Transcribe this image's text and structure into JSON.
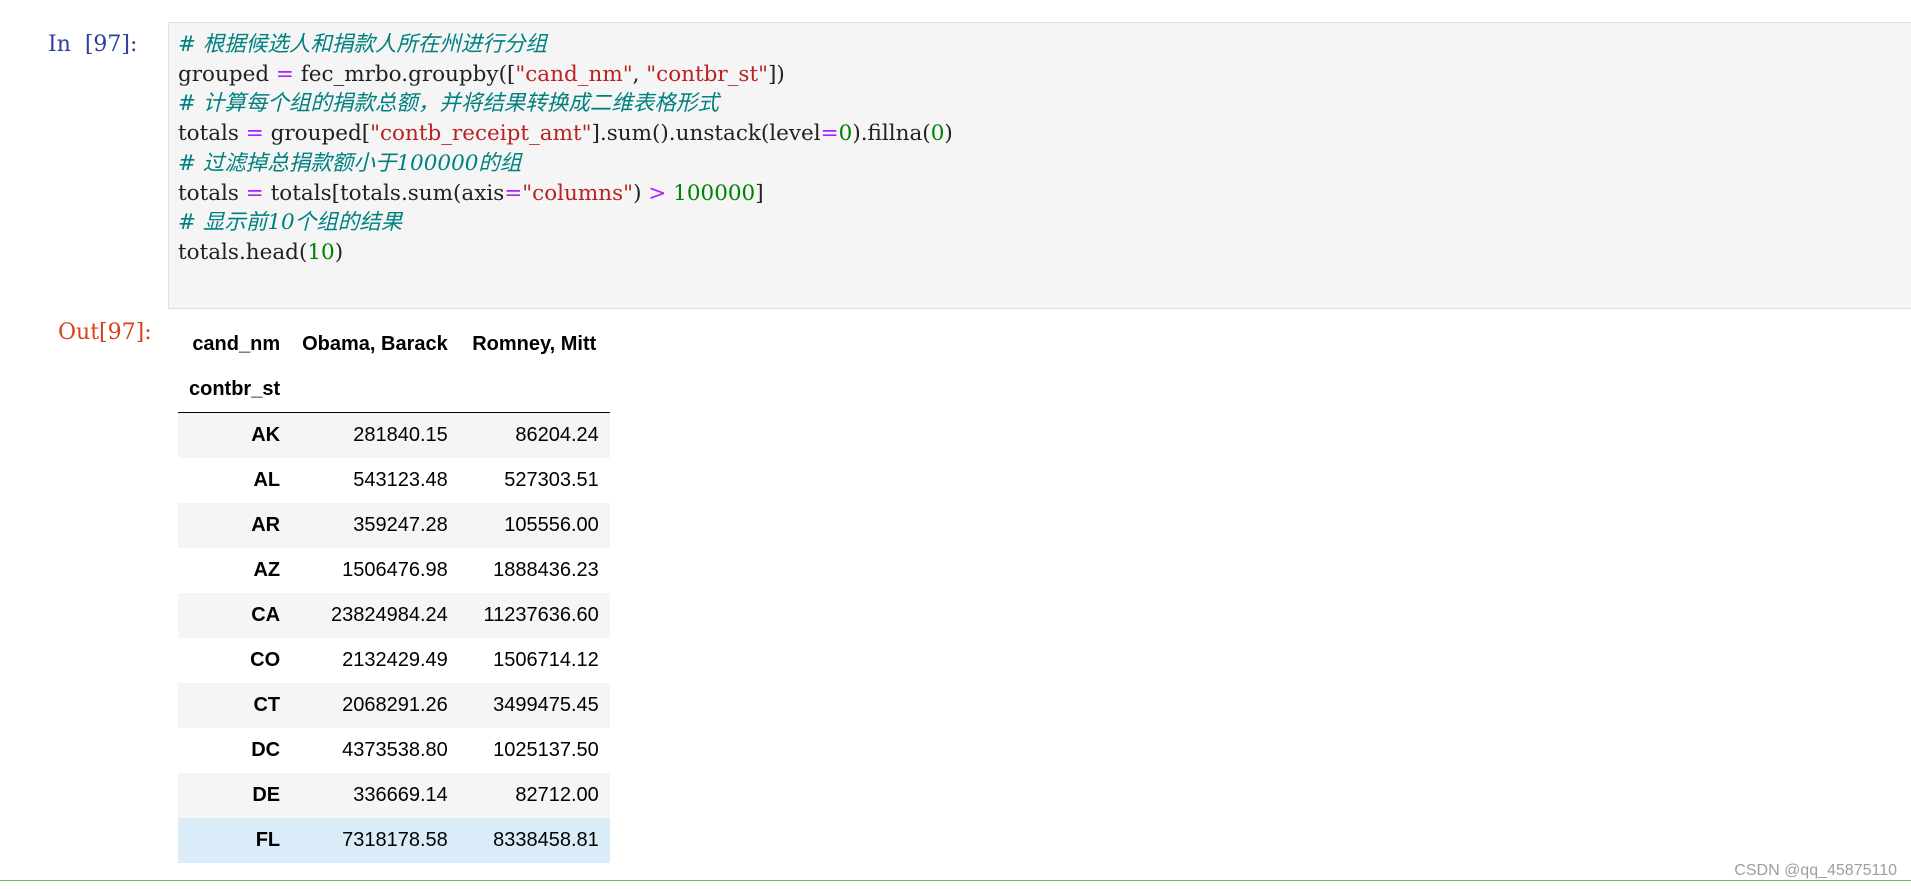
{
  "input_cell": {
    "prompt": "In  [97]:",
    "code_lines": [
      [
        {
          "t": "cm",
          "v": "# 根据候选人和捐款人所在州进行分组"
        }
      ],
      [
        {
          "t": "",
          "v": "grouped "
        },
        {
          "t": "op",
          "v": "="
        },
        {
          "t": "",
          "v": " fec_mrbo.groupby(["
        },
        {
          "t": "str",
          "v": "\"cand_nm\""
        },
        {
          "t": "",
          "v": ", "
        },
        {
          "t": "str",
          "v": "\"contbr_st\""
        },
        {
          "t": "",
          "v": "])"
        }
      ],
      [
        {
          "t": "cm",
          "v": "# 计算每个组的捐款总额，并将结果转换成二维表格形式"
        }
      ],
      [
        {
          "t": "",
          "v": "totals "
        },
        {
          "t": "op",
          "v": "="
        },
        {
          "t": "",
          "v": " grouped["
        },
        {
          "t": "str",
          "v": "\"contb_receipt_amt\""
        },
        {
          "t": "",
          "v": "].sum().unstack(level"
        },
        {
          "t": "op",
          "v": "="
        },
        {
          "t": "num",
          "v": "0"
        },
        {
          "t": "",
          "v": ").fillna("
        },
        {
          "t": "num",
          "v": "0"
        },
        {
          "t": "",
          "v": ")"
        }
      ],
      [
        {
          "t": "cm",
          "v": "# 过滤掉总捐款额小于100000的组"
        }
      ],
      [
        {
          "t": "",
          "v": "totals "
        },
        {
          "t": "op",
          "v": "="
        },
        {
          "t": "",
          "v": " totals[totals.sum(axis"
        },
        {
          "t": "op",
          "v": "="
        },
        {
          "t": "str",
          "v": "\"columns\""
        },
        {
          "t": "",
          "v": ") "
        },
        {
          "t": "op",
          "v": ">"
        },
        {
          "t": "",
          "v": " "
        },
        {
          "t": "num",
          "v": "100000"
        },
        {
          "t": "",
          "v": "]"
        }
      ],
      [
        {
          "t": "cm",
          "v": "# 显示前10个组的结果"
        }
      ],
      [
        {
          "t": "",
          "v": "totals.head("
        },
        {
          "t": "num",
          "v": "10"
        },
        {
          "t": "",
          "v": ")"
        }
      ]
    ]
  },
  "output_cell": {
    "prompt": "Out[97]:",
    "table": {
      "columns_name": "cand_nm",
      "index_name": "contbr_st",
      "columns": [
        "Obama, Barack",
        "Romney, Mitt"
      ],
      "rows": [
        {
          "index": "AK",
          "values": [
            "281840.15",
            "86204.24"
          ]
        },
        {
          "index": "AL",
          "values": [
            "543123.48",
            "527303.51"
          ]
        },
        {
          "index": "AR",
          "values": [
            "359247.28",
            "105556.00"
          ]
        },
        {
          "index": "AZ",
          "values": [
            "1506476.98",
            "1888436.23"
          ]
        },
        {
          "index": "CA",
          "values": [
            "23824984.24",
            "11237636.60"
          ]
        },
        {
          "index": "CO",
          "values": [
            "2132429.49",
            "1506714.12"
          ]
        },
        {
          "index": "CT",
          "values": [
            "2068291.26",
            "3499475.45"
          ]
        },
        {
          "index": "DC",
          "values": [
            "4373538.80",
            "1025137.50"
          ]
        },
        {
          "index": "DE",
          "values": [
            "336669.14",
            "82712.00"
          ]
        },
        {
          "index": "FL",
          "values": [
            "7318178.58",
            "8338458.81"
          ],
          "highlighted": true
        }
      ]
    }
  },
  "watermark": "CSDN @qq_45875110",
  "colors": {
    "in_prompt": "#303f9f",
    "out_prompt": "#d84315",
    "comment": "#008080",
    "operator": "#aa22ff",
    "string": "#ba2121",
    "number": "#008000",
    "row_highlight": "#d9ecf8"
  }
}
